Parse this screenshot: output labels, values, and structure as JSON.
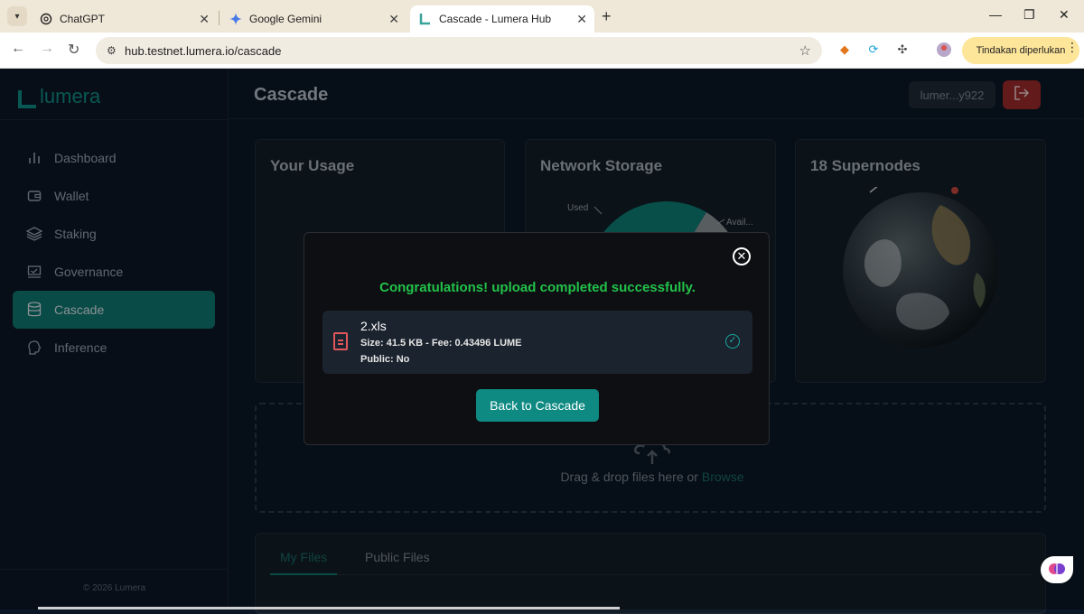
{
  "browser": {
    "tabs": [
      {
        "label": "ChatGPT"
      },
      {
        "label": "Google Gemini"
      },
      {
        "label": "Cascade - Lumera Hub"
      }
    ],
    "url": "hub.testnet.lumera.io/cascade",
    "action_pill": "Tindakan diperlukan"
  },
  "app": {
    "logo": "lumera",
    "page_title": "Cascade",
    "wallet_address": "lumer...y922",
    "nav": [
      {
        "label": "Dashboard"
      },
      {
        "label": "Wallet"
      },
      {
        "label": "Staking"
      },
      {
        "label": "Governance"
      },
      {
        "label": "Cascade"
      },
      {
        "label": "Inference"
      }
    ],
    "footer": "© 2026 Lumera",
    "cards": {
      "usage_title": "Your Usage",
      "storage_title": "Network Storage",
      "storage_used_label": "Used",
      "storage_available_label": "Avail...",
      "supernodes_title": "18 Supernodes"
    },
    "dropzone": {
      "text": "Drag & drop files here or",
      "link": "Browse"
    },
    "file_tabs": [
      {
        "label": "My Files"
      },
      {
        "label": "Public Files"
      }
    ]
  },
  "modal": {
    "message": "Congratulations! upload completed successfully.",
    "file_name": "2.xls",
    "file_meta": "Size: 41.5 KB - Fee: 0.43496 LUME",
    "file_public": "Public: No",
    "back_button": "Back to Cascade"
  },
  "colors": {
    "accent": "#0f7a72",
    "success": "#22c24a",
    "danger": "#9e2a2a"
  }
}
